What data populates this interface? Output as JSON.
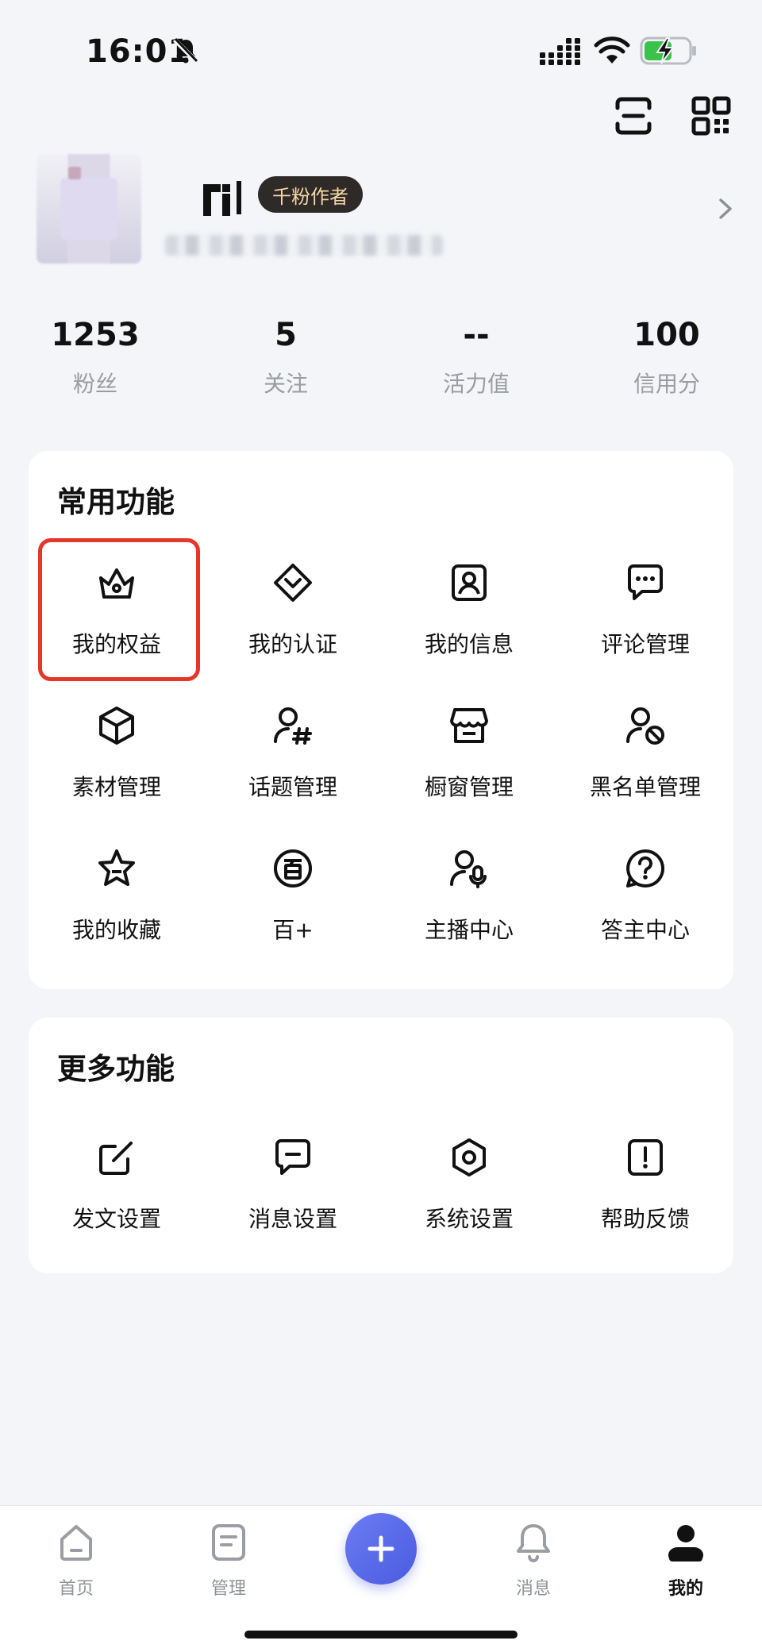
{
  "status_bar": {
    "time": "16:01"
  },
  "profile": {
    "name_glyph": "ril",
    "badge": "千粉作者"
  },
  "stats": [
    {
      "value": "1253",
      "label": "粉丝"
    },
    {
      "value": "5",
      "label": "关注"
    },
    {
      "value": "--",
      "label": "活力值"
    },
    {
      "value": "100",
      "label": "信用分"
    }
  ],
  "common": {
    "title": "常用功能",
    "items": [
      {
        "label": "我的权益",
        "icon": "crown-icon"
      },
      {
        "label": "我的认证",
        "icon": "verify-icon"
      },
      {
        "label": "我的信息",
        "icon": "id-card-icon"
      },
      {
        "label": "评论管理",
        "icon": "comment-icon"
      },
      {
        "label": "素材管理",
        "icon": "box-icon"
      },
      {
        "label": "话题管理",
        "icon": "topic-icon"
      },
      {
        "label": "橱窗管理",
        "icon": "shop-icon"
      },
      {
        "label": "黑名单管理",
        "icon": "blocked-user-icon"
      },
      {
        "label": "我的收藏",
        "icon": "star-icon"
      },
      {
        "label": "百+",
        "icon": "bai-icon"
      },
      {
        "label": "主播中心",
        "icon": "host-mic-icon"
      },
      {
        "label": "答主中心",
        "icon": "question-icon"
      }
    ]
  },
  "more": {
    "title": "更多功能",
    "items": [
      {
        "label": "发文设置",
        "icon": "edit-icon"
      },
      {
        "label": "消息设置",
        "icon": "message-icon"
      },
      {
        "label": "系统设置",
        "icon": "settings-icon"
      },
      {
        "label": "帮助反馈",
        "icon": "feedback-icon"
      }
    ]
  },
  "nav": {
    "home": "首页",
    "manage": "管理",
    "messages": "消息",
    "mine": "我的"
  },
  "colors": {
    "accent": "#5568e8",
    "highlight": "#e4372a",
    "badge_bg": "#2e2a27",
    "badge_text": "#f5d8a6"
  }
}
